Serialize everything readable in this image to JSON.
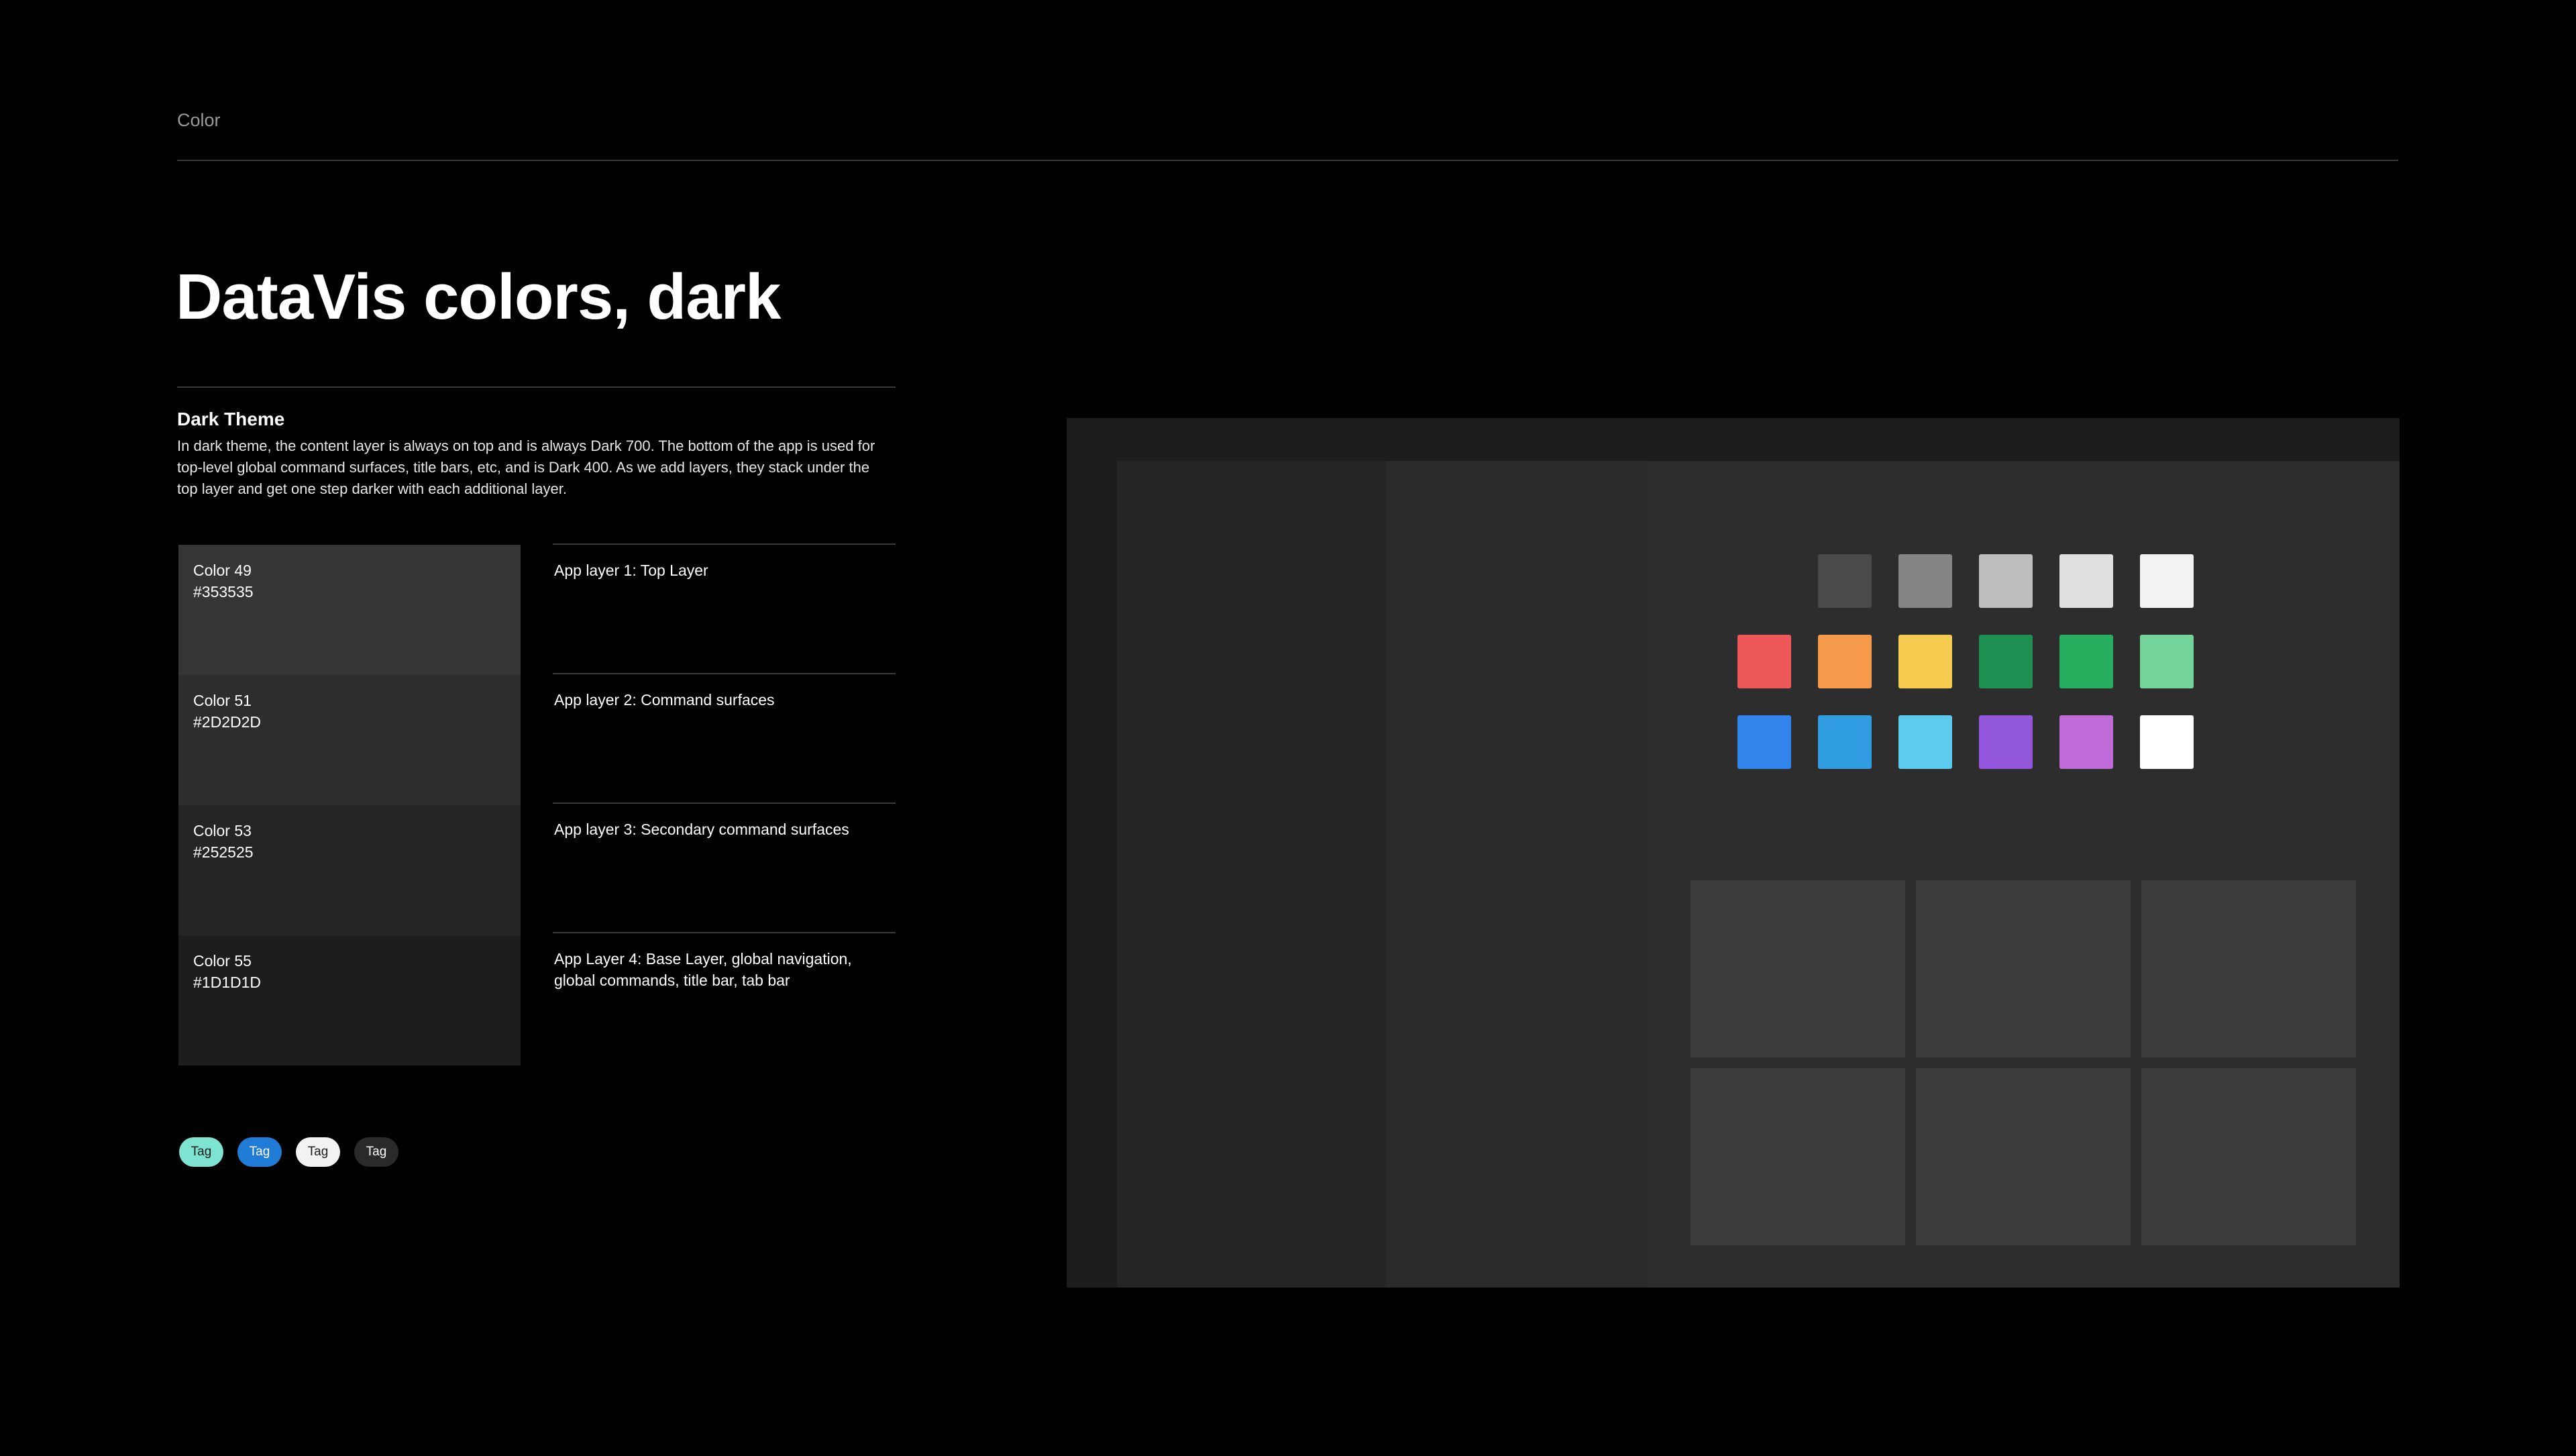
{
  "header": {
    "section": "Color"
  },
  "title": "DataVis colors, dark",
  "theme": {
    "heading": "Dark Theme",
    "description": "In dark theme, the content layer is always on top and is always Dark 700.  The bottom of the app is used for top-level global command surfaces, title bars, etc, and is Dark 400. As we add layers, they stack under the top layer and get one step darker with each additional layer."
  },
  "swatches": [
    {
      "name": "Color 49",
      "hex": "#353535"
    },
    {
      "name": "Color 51",
      "hex": "#2D2D2D"
    },
    {
      "name": "Color 53",
      "hex": "#252525"
    },
    {
      "name": "Color 55",
      "hex": "#1D1D1D"
    }
  ],
  "layers": [
    {
      "label": "App layer 1: Top Layer"
    },
    {
      "label": "App layer 2: Command surfaces"
    },
    {
      "label": "App layer 3: Secondary command surfaces"
    },
    {
      "label": "App Layer 4: Base Layer, global navigation, global commands, title bar, tab bar"
    }
  ],
  "tags": [
    {
      "label": "Tag",
      "bg": "#7fe3d2",
      "fg": "#1a1a1a"
    },
    {
      "label": "Tag",
      "bg": "#1f7bd6",
      "fg": "#ffffff"
    },
    {
      "label": "Tag",
      "bg": "#f2f2f2",
      "fg": "#1a1a1a"
    },
    {
      "label": "Tag",
      "bg": "#2a2a2a",
      "fg": "#ffffff"
    }
  ],
  "mockup": {
    "colors": {
      "base": "#1d1d1d",
      "nav": "#252525",
      "command": "#2a2a2a",
      "content": "#2d2d2d",
      "card": "#3d3d3d"
    },
    "palette": [
      [
        null,
        "#4a4a4a",
        "#858585",
        "#bdbdbd",
        "#e0e0e0",
        "#f2f2f2"
      ],
      [
        "#ef5858",
        "#f49a4a",
        "#f5cc50",
        "#1f8f52",
        "#26ad5e",
        "#75d49a"
      ],
      [
        "#3084ea",
        "#2f9de0",
        "#5ccbee",
        "#9256dd",
        "#bf6bd8",
        "#ffffff"
      ]
    ]
  }
}
